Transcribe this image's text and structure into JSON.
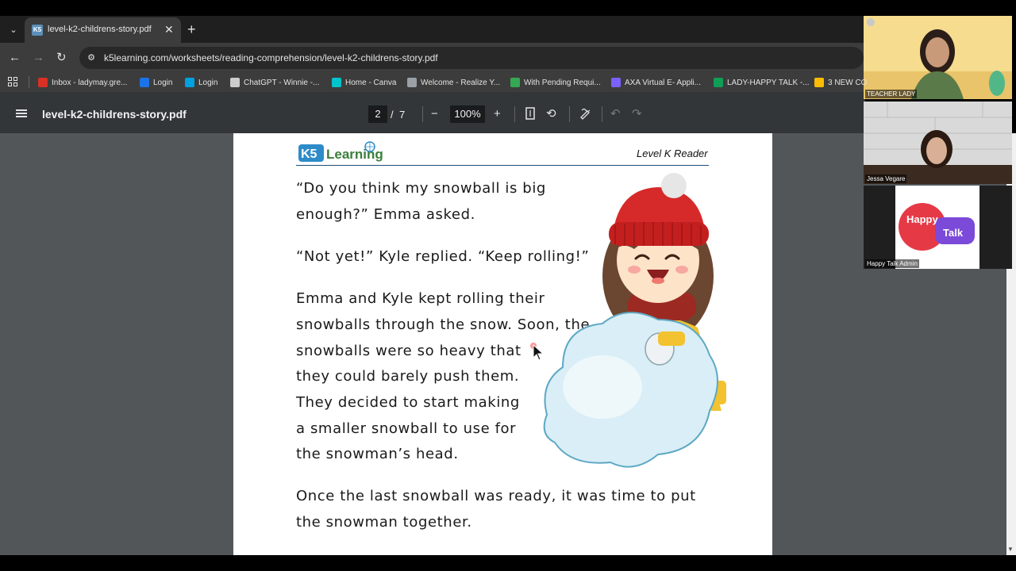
{
  "browser": {
    "tab": {
      "title": "level-k2-childrens-story.pdf"
    },
    "url": "k5learning.com/worksheets/reading-comprehension/level-k2-childrens-story.pdf",
    "bookmarks": [
      {
        "label": "Inbox - ladymay.gre...",
        "icon": "gmail-icon",
        "color": "#d93025"
      },
      {
        "label": "Login",
        "icon": "login-icon",
        "color": "#1a73e8"
      },
      {
        "label": "Login",
        "icon": "salesforce-icon",
        "color": "#00a1e0"
      },
      {
        "label": "ChatGPT - Winnie -...",
        "icon": "chatgpt-icon",
        "color": "#cccccc"
      },
      {
        "label": "Home - Canva",
        "icon": "canva-icon",
        "color": "#00c4cc"
      },
      {
        "label": "Welcome - Realize Y...",
        "icon": "globe-icon",
        "color": "#9aa0a6"
      },
      {
        "label": "With Pending Requi...",
        "icon": "chat-icon",
        "color": "#34a853"
      },
      {
        "label": "AXA Virtual E- Appli...",
        "icon": "list-icon",
        "color": "#7b61ff"
      },
      {
        "label": "LADY-HAPPY TALK -...",
        "icon": "sheets-icon",
        "color": "#0f9d58"
      },
      {
        "label": "3 NEW CO",
        "icon": "drive-icon",
        "color": "#fbbc04"
      }
    ]
  },
  "pdf_viewer": {
    "title": "level-k2-childrens-story.pdf",
    "current_page": "2",
    "page_separator": "/",
    "total_pages": "7",
    "zoom": "100%",
    "buttons": {
      "zoom_out": "−",
      "zoom_in": "+"
    }
  },
  "document": {
    "logo_text": "K5 Learning",
    "header": "Level K Reader",
    "lines": [
      "“Do you think my snowball is big",
      "enough?” Emma asked.",
      "“Not yet!” Kyle replied. “Keep rolling!”",
      "Emma and Kyle kept rolling their",
      "snowballs through the snow. Soon, the",
      "snowballs were so heavy that",
      "they could barely push them.",
      "They decided to start making",
      "a smaller snowball to use for",
      "the snowman’s head.",
      "Once the last snowball was ready, it was time to put",
      "the snowman together."
    ]
  },
  "call": {
    "participants": [
      {
        "name": "TEACHER LADY"
      },
      {
        "name": "Jessa Vegare"
      },
      {
        "name": "Happy Talk Admin",
        "logo_top": "Happy",
        "logo_bottom": "Talk"
      }
    ]
  },
  "colors": {
    "chrome_dark": "#1f1f1f",
    "chrome": "#3c3c3c",
    "pdf_toolbar": "#323639",
    "viewer_bg": "#525659",
    "rule": "#1f4e79"
  }
}
